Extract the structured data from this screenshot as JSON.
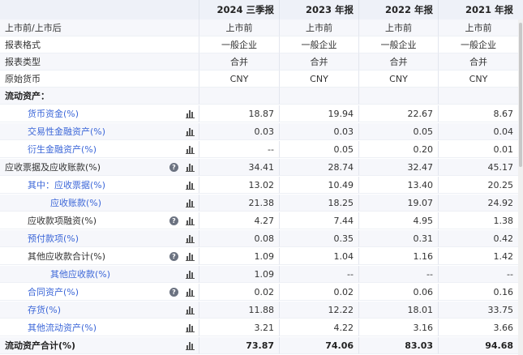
{
  "header": {
    "corner": "",
    "periods": [
      "2024 三季报",
      "2023 年报",
      "2022 年报",
      "2021 年报"
    ]
  },
  "meta_rows": [
    {
      "label": "上市前/上市后",
      "values": [
        "上市前",
        "上市前",
        "上市前",
        "上市前"
      ]
    },
    {
      "label": "报表格式",
      "values": [
        "一般企业",
        "一般企业",
        "一般企业",
        "一般企业"
      ]
    },
    {
      "label": "报表类型",
      "values": [
        "合并",
        "合并",
        "合并",
        "合并"
      ]
    },
    {
      "label": "原始货币",
      "values": [
        "CNY",
        "CNY",
        "CNY",
        "CNY"
      ]
    }
  ],
  "section": {
    "label": "流动资产："
  },
  "data_rows": [
    {
      "label": "货币资金(%)",
      "values": [
        "18.87",
        "19.94",
        "22.67",
        "8.67"
      ]
    },
    {
      "label": "交易性金融资产(%)",
      "values": [
        "0.03",
        "0.03",
        "0.05",
        "0.04"
      ]
    },
    {
      "label": "衍生金融资产(%)",
      "values": [
        "--",
        "0.05",
        "0.20",
        "0.01"
      ]
    },
    {
      "label": "应收票据及应收账款(%)",
      "values": [
        "34.41",
        "28.74",
        "32.47",
        "45.17"
      ]
    },
    {
      "label": "其中：应收票据(%)",
      "values": [
        "13.02",
        "10.49",
        "13.40",
        "20.25"
      ]
    },
    {
      "label": "应收账款(%)",
      "values": [
        "21.38",
        "18.25",
        "19.07",
        "24.92"
      ]
    },
    {
      "label": "应收款项融资(%)",
      "values": [
        "4.27",
        "7.44",
        "4.95",
        "1.38"
      ]
    },
    {
      "label": "预付款项(%)",
      "values": [
        "0.08",
        "0.35",
        "0.31",
        "0.42"
      ]
    },
    {
      "label": "其他应收款合计(%)",
      "values": [
        "1.09",
        "1.04",
        "1.16",
        "1.42"
      ]
    },
    {
      "label": "其他应收款(%)",
      "values": [
        "1.09",
        "--",
        "--",
        "--"
      ]
    },
    {
      "label": "合同资产(%)",
      "values": [
        "0.02",
        "0.02",
        "0.06",
        "0.16"
      ]
    },
    {
      "label": "存货(%)",
      "values": [
        "11.88",
        "12.22",
        "18.01",
        "33.75"
      ]
    },
    {
      "label": "其他流动资产(%)",
      "values": [
        "3.21",
        "4.22",
        "3.16",
        "3.66"
      ]
    },
    {
      "label": "流动资产合计(%)",
      "values": [
        "73.87",
        "74.06",
        "83.03",
        "94.68"
      ]
    }
  ],
  "icons": {
    "help": "question-circle-icon",
    "chart": "bar-chart-icon"
  }
}
